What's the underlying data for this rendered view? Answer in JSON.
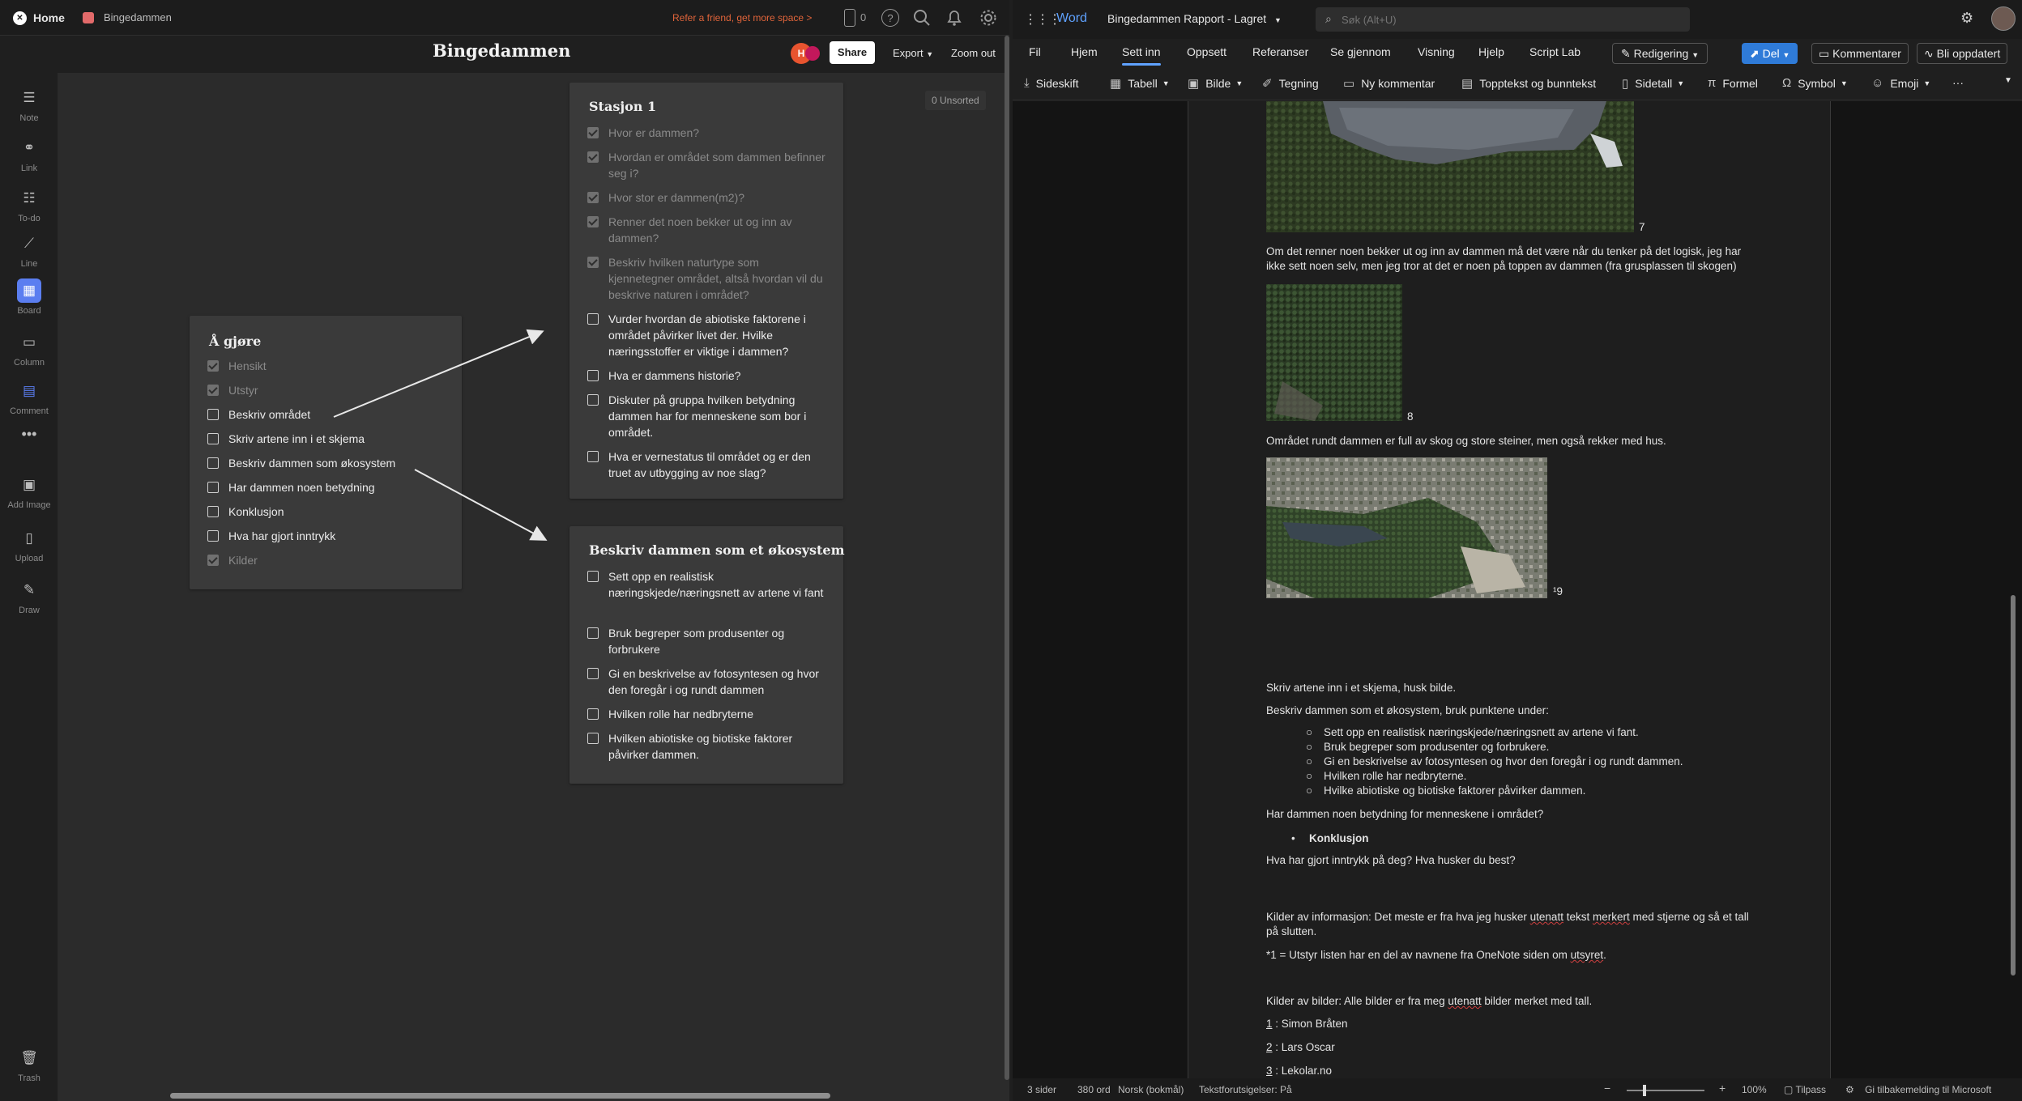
{
  "milanote": {
    "topbar": {
      "home": "Home",
      "board_crumb": "Bingedammen",
      "refer": "Refer a friend, get more space >",
      "device_count": "0"
    },
    "board_title": "Bingedammen",
    "avatar_letter": "H",
    "share": "Share",
    "export": "Export",
    "zoom_out": "Zoom out",
    "unsorted": "0 Unsorted",
    "tools": [
      "Note",
      "Link",
      "To-do",
      "Line",
      "Board",
      "Column",
      "Comment",
      "Add Image",
      "Upload",
      "Draw"
    ],
    "trash": "Trash",
    "card_agjore": {
      "title": "Å gjøre",
      "items": [
        {
          "text": "Hensikt",
          "done": true
        },
        {
          "text": "Utstyr",
          "done": true
        },
        {
          "text": "Beskriv området",
          "done": false
        },
        {
          "text": "Skriv artene inn i et skjema",
          "done": false
        },
        {
          "text": "Beskriv dammen som økosystem",
          "done": false
        },
        {
          "text": "Har dammen noen betydning",
          "done": false
        },
        {
          "text": "Konklusjon",
          "done": false
        },
        {
          "text": "Hva har gjort inntrykk",
          "done": false
        },
        {
          "text": "Kilder",
          "done": true
        }
      ]
    },
    "card_stasjon": {
      "title": "Stasjon 1",
      "items": [
        {
          "text": "Hvor er dammen?",
          "done": true
        },
        {
          "text": "Hvordan er området som dammen befinner seg i?",
          "done": true
        },
        {
          "text": "Hvor stor er dammen(m2)?",
          "done": true
        },
        {
          "text": "Renner det noen bekker ut og inn av dammen?",
          "done": true
        },
        {
          "text": "Beskriv hvilken naturtype som kjennetegner området, altså hvordan vil du beskrive naturen i området?",
          "done": true
        },
        {
          "text": "Vurder hvordan de abiotiske faktorene i området påvirker livet der. Hvilke næringsstoffer er viktige i dammen?",
          "done": false
        },
        {
          "text": "Hva er dammens historie?",
          "done": false
        },
        {
          "text": "Diskuter på gruppa hvilken betydning dammen har for menneskene som bor i området.",
          "done": false
        },
        {
          "text": "Hva er vernestatus til området og er den truet av utbygging av noe slag?",
          "done": false
        }
      ]
    },
    "card_okosystem": {
      "title": "Beskriv dammen som et økosystem",
      "items": [
        {
          "text": "Sett opp en realistisk næringskjede/næringsnett av artene vi fant",
          "done": false
        },
        {
          "text": "Bruk begreper som produsenter og forbrukere",
          "done": false
        },
        {
          "text": "Gi en beskrivelse av fotosyntesen og hvor den foregår i og rundt dammen",
          "done": false
        },
        {
          "text": "Hvilken rolle har nedbryterne",
          "done": false
        },
        {
          "text": "Hvilken abiotiske og biotiske faktorer påvirker dammen.",
          "done": false
        }
      ]
    }
  },
  "word": {
    "app": "Word",
    "doc_title": "Bingedammen Rapport",
    "saved": "Lagret",
    "search_placeholder": "Søk (Alt+U)",
    "menu": [
      "Fil",
      "Hjem",
      "Sett inn",
      "Oppsett",
      "Referanser",
      "Se gjennom",
      "Visning",
      "Hjelp",
      "Script Lab"
    ],
    "active_menu": "Sett inn",
    "editing": "Redigering",
    "share": "Del",
    "comments": "Kommentarer",
    "catch_up": "Bli oppdatert",
    "tools": [
      "Sideskift",
      "Tabell",
      "Bilde",
      "Tegning",
      "Ny kommentar",
      "Topptekst og bunntekst",
      "Sidetall",
      "Formel",
      "Symbol",
      "Emoji"
    ],
    "doc": {
      "num7": "7",
      "para1": "Om det renner noen bekker ut og inn av dammen må det være når du tenker på det logisk, jeg har ikke sett noen selv, men jeg tror at det er noen på toppen av dammen (fra grusplassen til skogen)",
      "num8": "8",
      "para2": "Området rundt dammen er full av skog og store steiner, men også rekker med hus.",
      "num9": "¹9",
      "para3": "Skriv artene inn i et skjema, husk bilde.",
      "para4": "Beskriv dammen som et økosystem, bruk punktene under:",
      "bullets": [
        "Sett opp en realistisk næringskjede/næringsnett av artene vi fant.",
        "Bruk begreper som produsenter og forbrukere.",
        "Gi en beskrivelse av fotosyntesen og hvor den foregår i og rundt dammen.",
        "Hvilken rolle har nedbryterne.",
        "Hvilke abiotiske og biotiske faktorer påvirker dammen."
      ],
      "para5": "Har dammen noen betydning for menneskene i området?",
      "konklusjon": "Konklusjon",
      "para6": "Hva har gjort inntrykk på deg? Hva husker du best?",
      "kilder1_a": "Kilder av informasjon: Det meste er fra hva jeg husker ",
      "kilder1_b": "utenatt",
      "kilder1_c": " tekst ",
      "kilder1_d": "merkert",
      "kilder1_e": " med stjerne og så et tall på slutten.",
      "note1_a": "*1 = Utstyr listen har en del av navnene fra OneNote siden om ",
      "note1_b": "utsyret",
      "note1_c": ".",
      "kilder2_a": "Kilder av bilder: Alle bilder er fra meg ",
      "kilder2_b": "utenatt",
      "kilder2_c": " bilder merket med tall.",
      "src1_n": "1",
      "src1": " : Simon Bråten",
      "src2_n": "2",
      "src2": " : Lars Oscar",
      "src3_n": "3",
      "src3": " : Lekolar.no"
    },
    "status": {
      "pages": "3 sider",
      "words": "380 ord",
      "lang": "Norsk (bokmål)",
      "predictions": "Tekstforutsigelser: På",
      "zoom": "100%",
      "fit": "Tilpass",
      "feedback": "Gi tilbakemelding til Microsoft"
    }
  },
  "colors": {
    "accent_orange": "#e8542f",
    "refer_orange": "#e0643a",
    "word_blue": "#2f7bd8",
    "board_icon_blue": "#5b7ef0"
  }
}
